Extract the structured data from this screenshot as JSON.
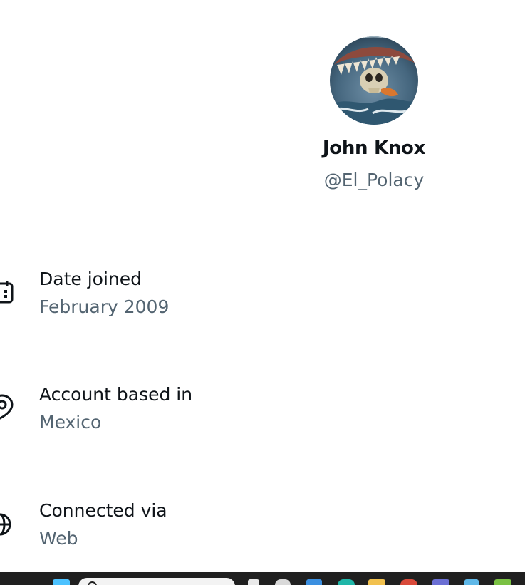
{
  "profile": {
    "display_name": "John Knox",
    "handle": "@El_Polacy"
  },
  "details": [
    {
      "icon": "calendar-icon",
      "label": "Date joined",
      "value": "February 2009"
    },
    {
      "icon": "location-pin-icon",
      "label": "Account based in",
      "value": "Mexico"
    },
    {
      "icon": "globe-icon",
      "label": "Connected via",
      "value": "Web"
    }
  ],
  "taskbar": {
    "icons": [
      "windows-start-icon",
      "search-icon",
      "task-view-icon",
      "copilot-icon",
      "vscode-icon",
      "edge-icon",
      "file-explorer-icon",
      "chrome-icon",
      "teams-icon",
      "store-icon",
      "excel-icon"
    ]
  },
  "colors": {
    "primary_text": "#0f1419",
    "secondary_text": "#536471",
    "taskbar": "#202020"
  }
}
